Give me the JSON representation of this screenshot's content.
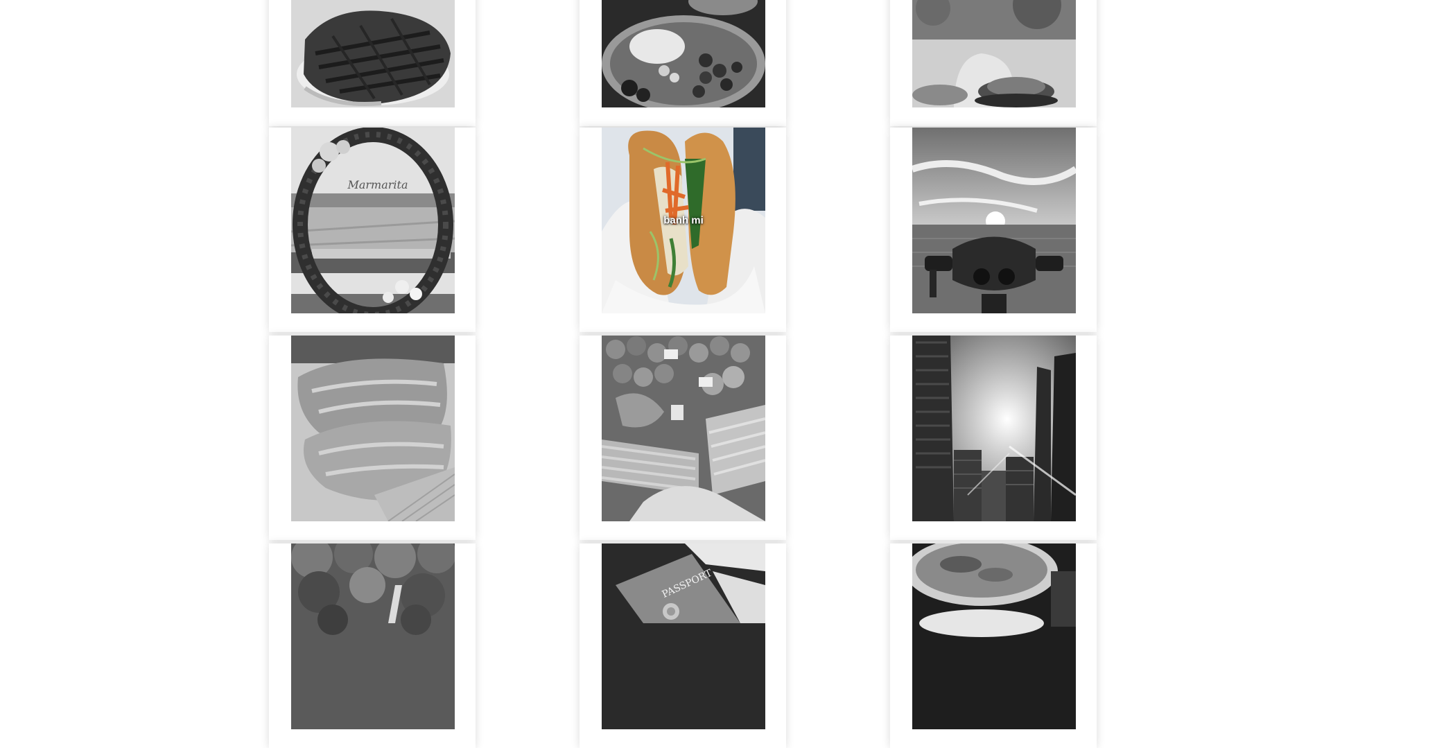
{
  "gallery": {
    "items": [
      {
        "id": "steak",
        "caption": "",
        "grayscale": true
      },
      {
        "id": "fruit-bowl",
        "caption": "",
        "grayscale": true
      },
      {
        "id": "patio-dish",
        "caption": "",
        "grayscale": true
      },
      {
        "id": "flower-arch",
        "caption": "",
        "grayscale": true
      },
      {
        "id": "banh-mi",
        "caption": "banh mi",
        "grayscale": false
      },
      {
        "id": "viewer-binoculars",
        "caption": "",
        "grayscale": true
      },
      {
        "id": "salmon-sushi",
        "caption": "",
        "grayscale": true
      },
      {
        "id": "market-produce",
        "caption": "",
        "grayscale": true
      },
      {
        "id": "city-towers",
        "caption": "",
        "grayscale": true
      },
      {
        "id": "forest-waterfall",
        "caption": "",
        "grayscale": true
      },
      {
        "id": "passport",
        "caption": "",
        "grayscale": true
      },
      {
        "id": "seafood-plate",
        "caption": "",
        "grayscale": true
      }
    ]
  },
  "passport_text": "PASSPORT",
  "arch_sign_text": "Marmarita"
}
